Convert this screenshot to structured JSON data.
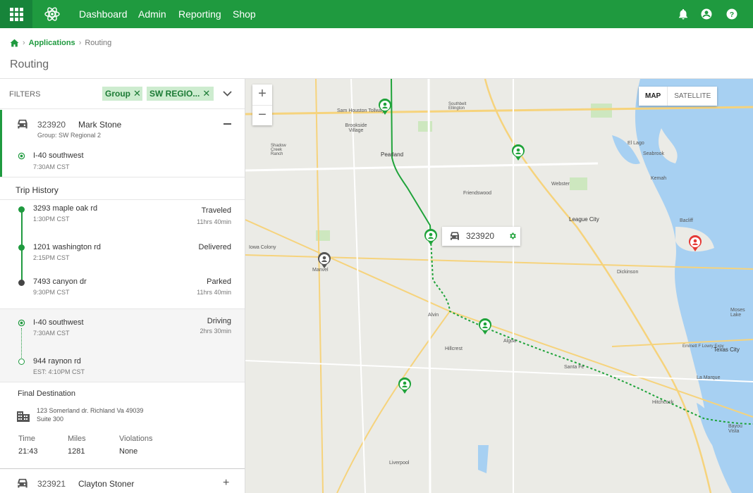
{
  "nav": {
    "items": [
      {
        "label": "Dashboard"
      },
      {
        "label": "Admin"
      },
      {
        "label": "Reporting"
      },
      {
        "label": "Shop"
      }
    ]
  },
  "breadcrumb": {
    "link": "Applications",
    "current": "Routing"
  },
  "page": {
    "title": "Routing"
  },
  "filters": {
    "label": "FILTERS",
    "chips": [
      {
        "label": "Group"
      },
      {
        "label": "SW REGIO..."
      }
    ]
  },
  "vehicle1": {
    "id": "323920",
    "name": "Mark Stone",
    "group": "Group: SW Regional 2",
    "location": "I-40 southwest",
    "time": "7:30AM CST"
  },
  "trip_history": {
    "title": "Trip History",
    "stops": [
      {
        "address": "3293 maple oak rd",
        "time": "1:30PM CST",
        "status": "Traveled",
        "duration": "11hrs 40min"
      },
      {
        "address": "1201 washington rd",
        "time": "2:15PM CST",
        "status": "Delivered",
        "duration": ""
      },
      {
        "address": "7493 canyon dr",
        "time": "9:30PM CST",
        "status": "Parked",
        "duration": "11hrs 40min"
      }
    ]
  },
  "current_trip": {
    "from": "I-40 southwest",
    "from_time": "7:30AM CST",
    "status": "Driving",
    "duration": "2hrs 30min",
    "to": "944 raynon rd",
    "to_time": "EST: 4:10PM CST"
  },
  "final_destination": {
    "title": "Final Destination",
    "address": "123 Somerland dr. Richland Va 49039",
    "suite": "Suite 300"
  },
  "stats": [
    {
      "label": "Time",
      "value": "21:43"
    },
    {
      "label": "Miles",
      "value": "1281"
    },
    {
      "label": "Violations",
      "value": "None"
    }
  ],
  "vehicle2": {
    "id": "323921",
    "name": "Clayton Stoner"
  },
  "map": {
    "type_map": "MAP",
    "type_satellite": "SATELLITE",
    "zoom_in": "+",
    "zoom_out": "−",
    "tooltip_id": "323920",
    "labels": [
      "Sam Houston Tollway",
      "Brookside Village",
      "Pearland",
      "Friendswood",
      "Webster",
      "League City",
      "El Lago",
      "Seabrook",
      "Kemah",
      "Bacliff",
      "Iowa Colony",
      "Manvel",
      "Dickinson",
      "Alvin",
      "Hillcrest",
      "Algoa",
      "Santa Fe",
      "Texas City",
      "La Marque",
      "Hitchcock",
      "Bayou Vista",
      "Liverpool",
      "Emmett F Lowry Expy",
      "Moses Lake",
      "Shadow Creek Ranch",
      "Southbelt Ellington"
    ]
  },
  "colors": {
    "brand": "#1f9a3f",
    "route": "#1fa33a",
    "alert": "#e53935",
    "water": "#a7d0f2"
  }
}
